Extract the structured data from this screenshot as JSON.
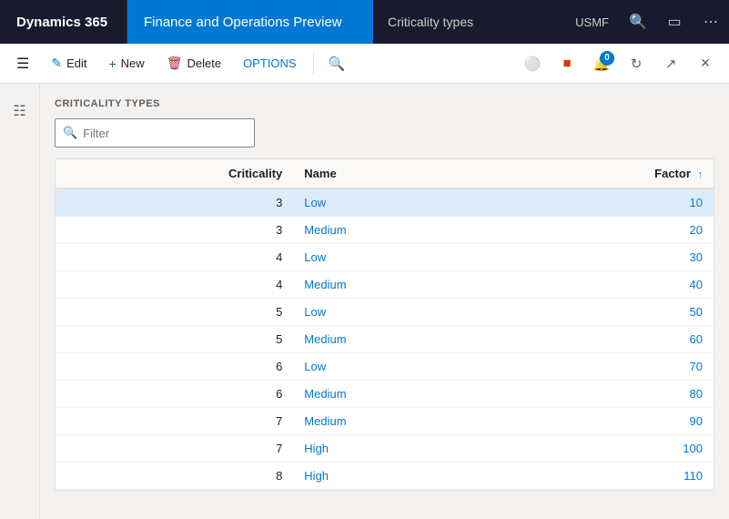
{
  "topNav": {
    "dynamics365": "Dynamics 365",
    "appName": "Finance and Operations Preview",
    "pageName": "Criticality types",
    "companyCode": "USMF"
  },
  "toolbar": {
    "editLabel": "Edit",
    "newLabel": "New",
    "deleteLabel": "Delete",
    "optionsLabel": "OPTIONS",
    "notificationCount": "0"
  },
  "content": {
    "sectionTitle": "CRITICALITY TYPES",
    "filterPlaceholder": "Filter"
  },
  "table": {
    "columns": [
      {
        "id": "criticality",
        "label": "Criticality",
        "sortable": false
      },
      {
        "id": "name",
        "label": "Name",
        "sortable": false
      },
      {
        "id": "factor",
        "label": "Factor",
        "sortable": true,
        "sortDir": "asc"
      }
    ],
    "rows": [
      {
        "criticality": "3",
        "name": "Low",
        "factor": "10",
        "selected": true
      },
      {
        "criticality": "3",
        "name": "Medium",
        "factor": "20",
        "selected": false
      },
      {
        "criticality": "4",
        "name": "Low",
        "factor": "30",
        "selected": false
      },
      {
        "criticality": "4",
        "name": "Medium",
        "factor": "40",
        "selected": false
      },
      {
        "criticality": "5",
        "name": "Low",
        "factor": "50",
        "selected": false
      },
      {
        "criticality": "5",
        "name": "Medium",
        "factor": "60",
        "selected": false
      },
      {
        "criticality": "6",
        "name": "Low",
        "factor": "70",
        "selected": false
      },
      {
        "criticality": "6",
        "name": "Medium",
        "factor": "80",
        "selected": false
      },
      {
        "criticality": "7",
        "name": "Medium",
        "factor": "90",
        "selected": false
      },
      {
        "criticality": "7",
        "name": "High",
        "factor": "100",
        "selected": false
      },
      {
        "criticality": "8",
        "name": "High",
        "factor": "110",
        "selected": false
      }
    ]
  }
}
